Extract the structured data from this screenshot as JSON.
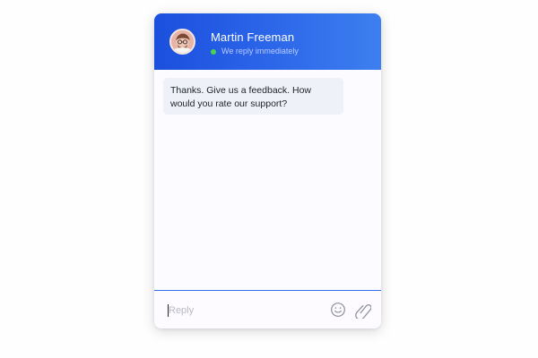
{
  "chat": {
    "agent_name": "Martin Freeman",
    "status_text": "We reply immediately",
    "message": "Thanks. Give us a feedback. How would you rate our support?",
    "reply_placeholder": "Reply"
  },
  "icons": {
    "avatar": "user-avatar",
    "status": "online-dot-icon",
    "emoji": "emoji-icon",
    "attachment": "paperclip-icon"
  },
  "colors": {
    "header_start": "#1b4fdd",
    "header_end": "#3d7ff0",
    "online": "#4bd34b",
    "input_border": "#2f6ee5",
    "bubble": "#eff1f8"
  }
}
